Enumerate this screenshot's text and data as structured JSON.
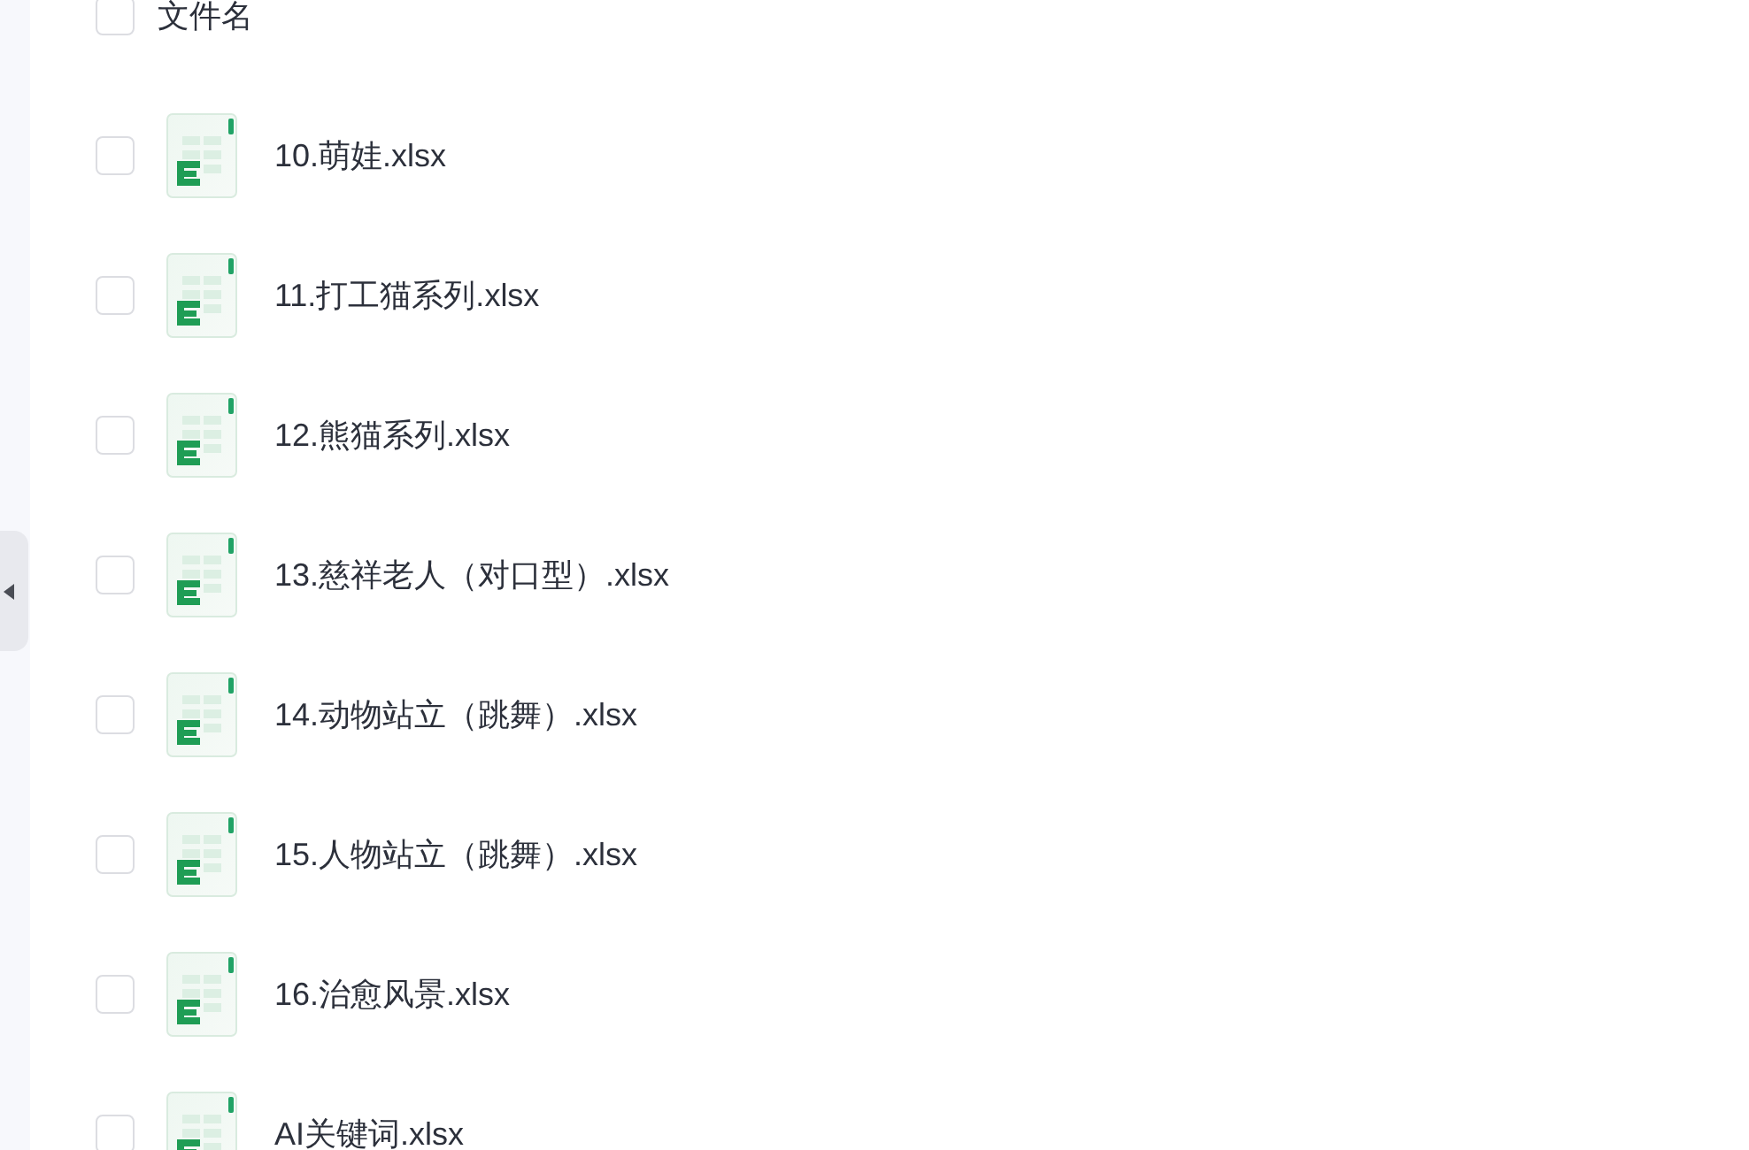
{
  "file_list": {
    "header": {
      "label": "文件名",
      "checked": false
    },
    "files": [
      {
        "name": "10.萌娃.xlsx",
        "checked": false
      },
      {
        "name": "11.打工猫系列.xlsx",
        "checked": false
      },
      {
        "name": "12.熊猫系列.xlsx",
        "checked": false
      },
      {
        "name": "13.慈祥老人（对口型）.xlsx",
        "checked": false
      },
      {
        "name": "14.动物站立（跳舞）.xlsx",
        "checked": false
      },
      {
        "name": "15.人物站立（跳舞）.xlsx",
        "checked": false
      },
      {
        "name": "16.治愈风景.xlsx",
        "checked": false
      },
      {
        "name": "AI关键词.xlsx",
        "checked": false
      }
    ]
  }
}
